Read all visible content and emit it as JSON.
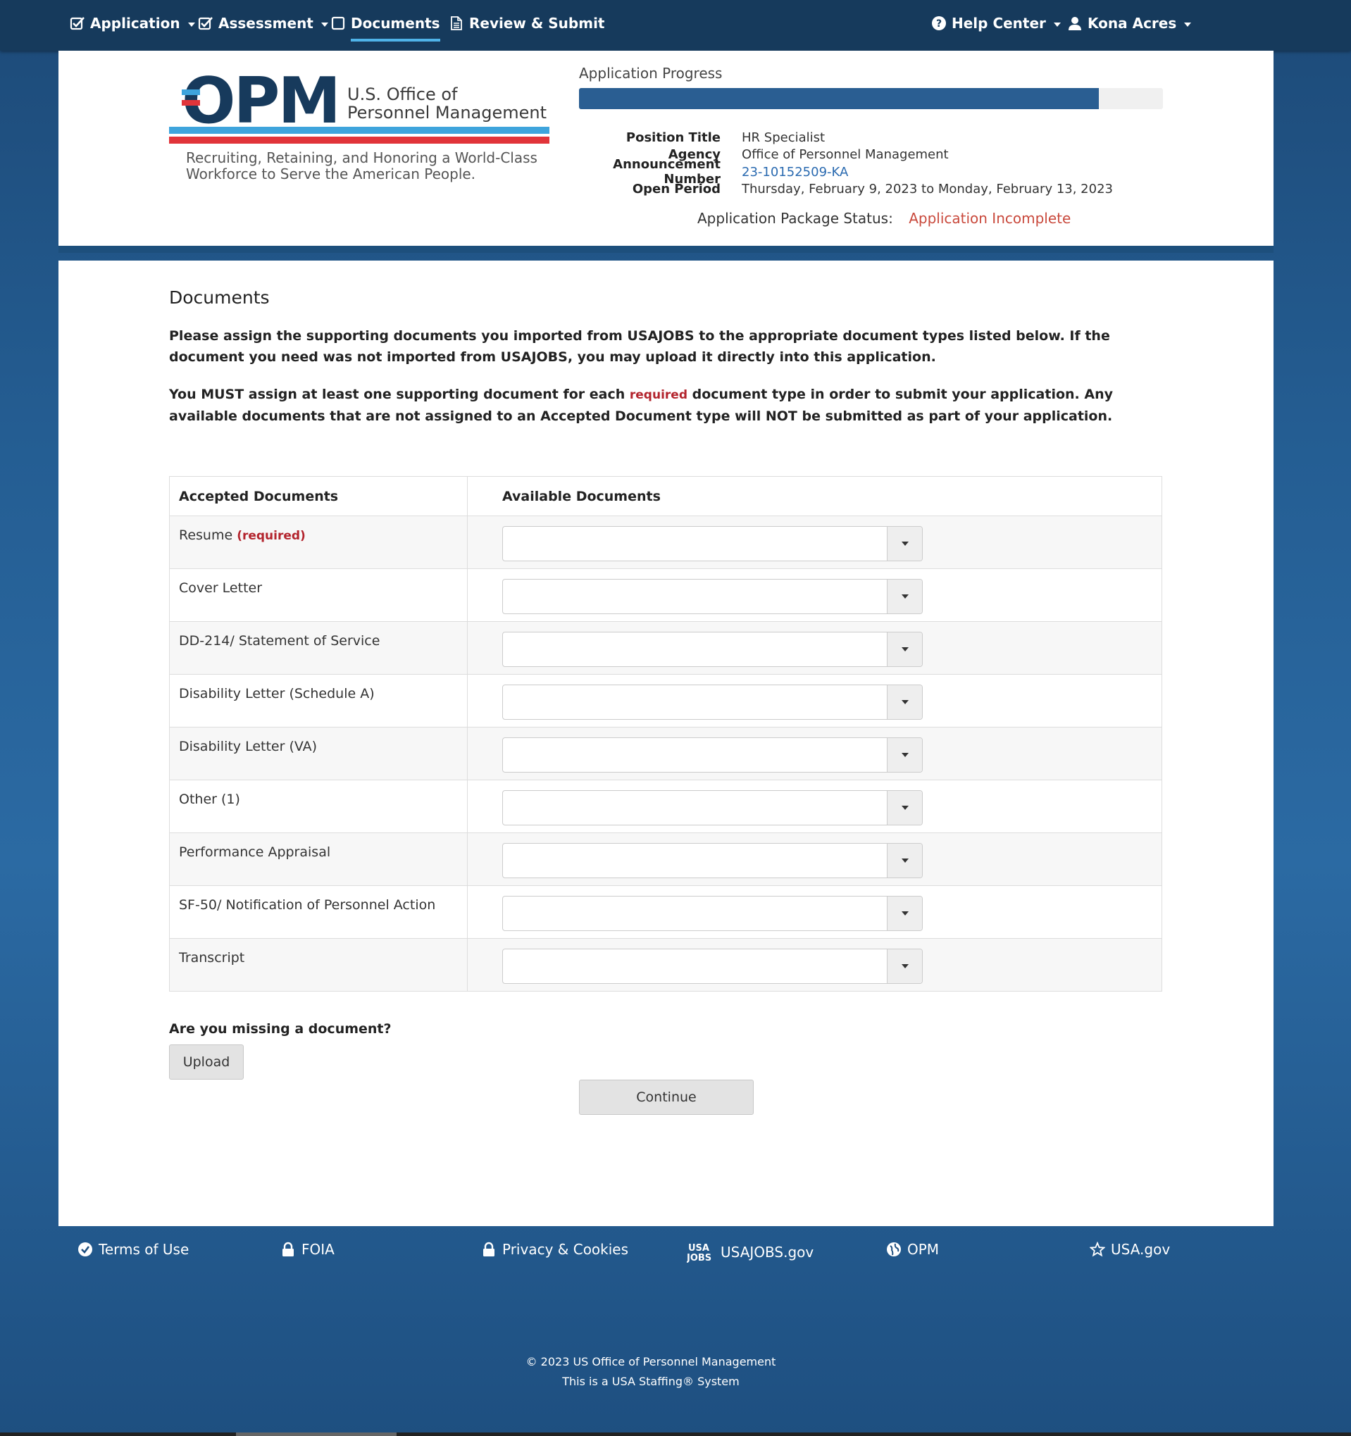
{
  "nav": {
    "application": "Application",
    "assessment": "Assessment",
    "documents": "Documents",
    "review_submit": "Review & Submit",
    "help_center": "Help Center",
    "user": "Kona Acres"
  },
  "logo": {
    "mark": "OPM",
    "org_line1": "U.S. Office of",
    "org_line2": "Personnel Management",
    "tagline_line1": "Recruiting, Retaining, and Honoring a World-Class",
    "tagline_line2": "Workforce to Serve the American People."
  },
  "progress": {
    "label": "Application Progress",
    "fraction": 0.89
  },
  "job_info": {
    "position_title_label": "Position Title",
    "position_title": "HR Specialist",
    "agency_label": "Agency",
    "agency": "Office of Personnel Management",
    "announcement_label": "Announcement Number",
    "announcement": "23-10152509-KA",
    "open_period_label": "Open Period",
    "open_period": "Thursday, February 9, 2023 to Monday, February 13, 2023",
    "status_label": "Application Package Status:",
    "status": "Application Incomplete"
  },
  "main": {
    "title": "Documents",
    "intro1": "Please assign the supporting documents you imported from USAJOBS to the appropriate document types listed below. If the document you need was not imported from USAJOBS, you may upload it directly into this application.",
    "intro2_part1": "You MUST assign at least one supporting document for each ",
    "intro2_required": "required",
    "intro2_part2": " document type in order to submit your application. Any available documents that are not assigned to an Accepted Document type will NOT be submitted as part of your application.",
    "col_accepted": "Accepted Documents",
    "col_available": "Available Documents",
    "required_tag": "(required)",
    "documents": [
      "Resume",
      "Cover Letter",
      "DD-214/ Statement of Service",
      "Disability Letter (Schedule A)",
      "Disability Letter (VA)",
      "Other (1)",
      "Performance Appraisal",
      "SF-50/ Notification of Personnel Action",
      "Transcript"
    ],
    "missing": "Are you missing a document?",
    "upload": "Upload",
    "continue": "Continue"
  },
  "footer": {
    "terms": "Terms of Use",
    "foia": "FOIA",
    "privacy": "Privacy & Cookies",
    "usajobs_logo_top": "USA",
    "usajobs_logo_bottom": "JOBS",
    "usajobs": "USAJOBS.gov",
    "opm": "OPM",
    "usagov": "USA.gov",
    "copyright": "© 2023 US Office of Personnel Management",
    "system": "This is a USA Staffing® System"
  },
  "colors": {
    "nav_bg": "#163a5c",
    "progress_fill": "#2a5e92",
    "status_red": "#c9493c",
    "required_red": "#b3242d",
    "link_blue": "#2a6ab0"
  }
}
